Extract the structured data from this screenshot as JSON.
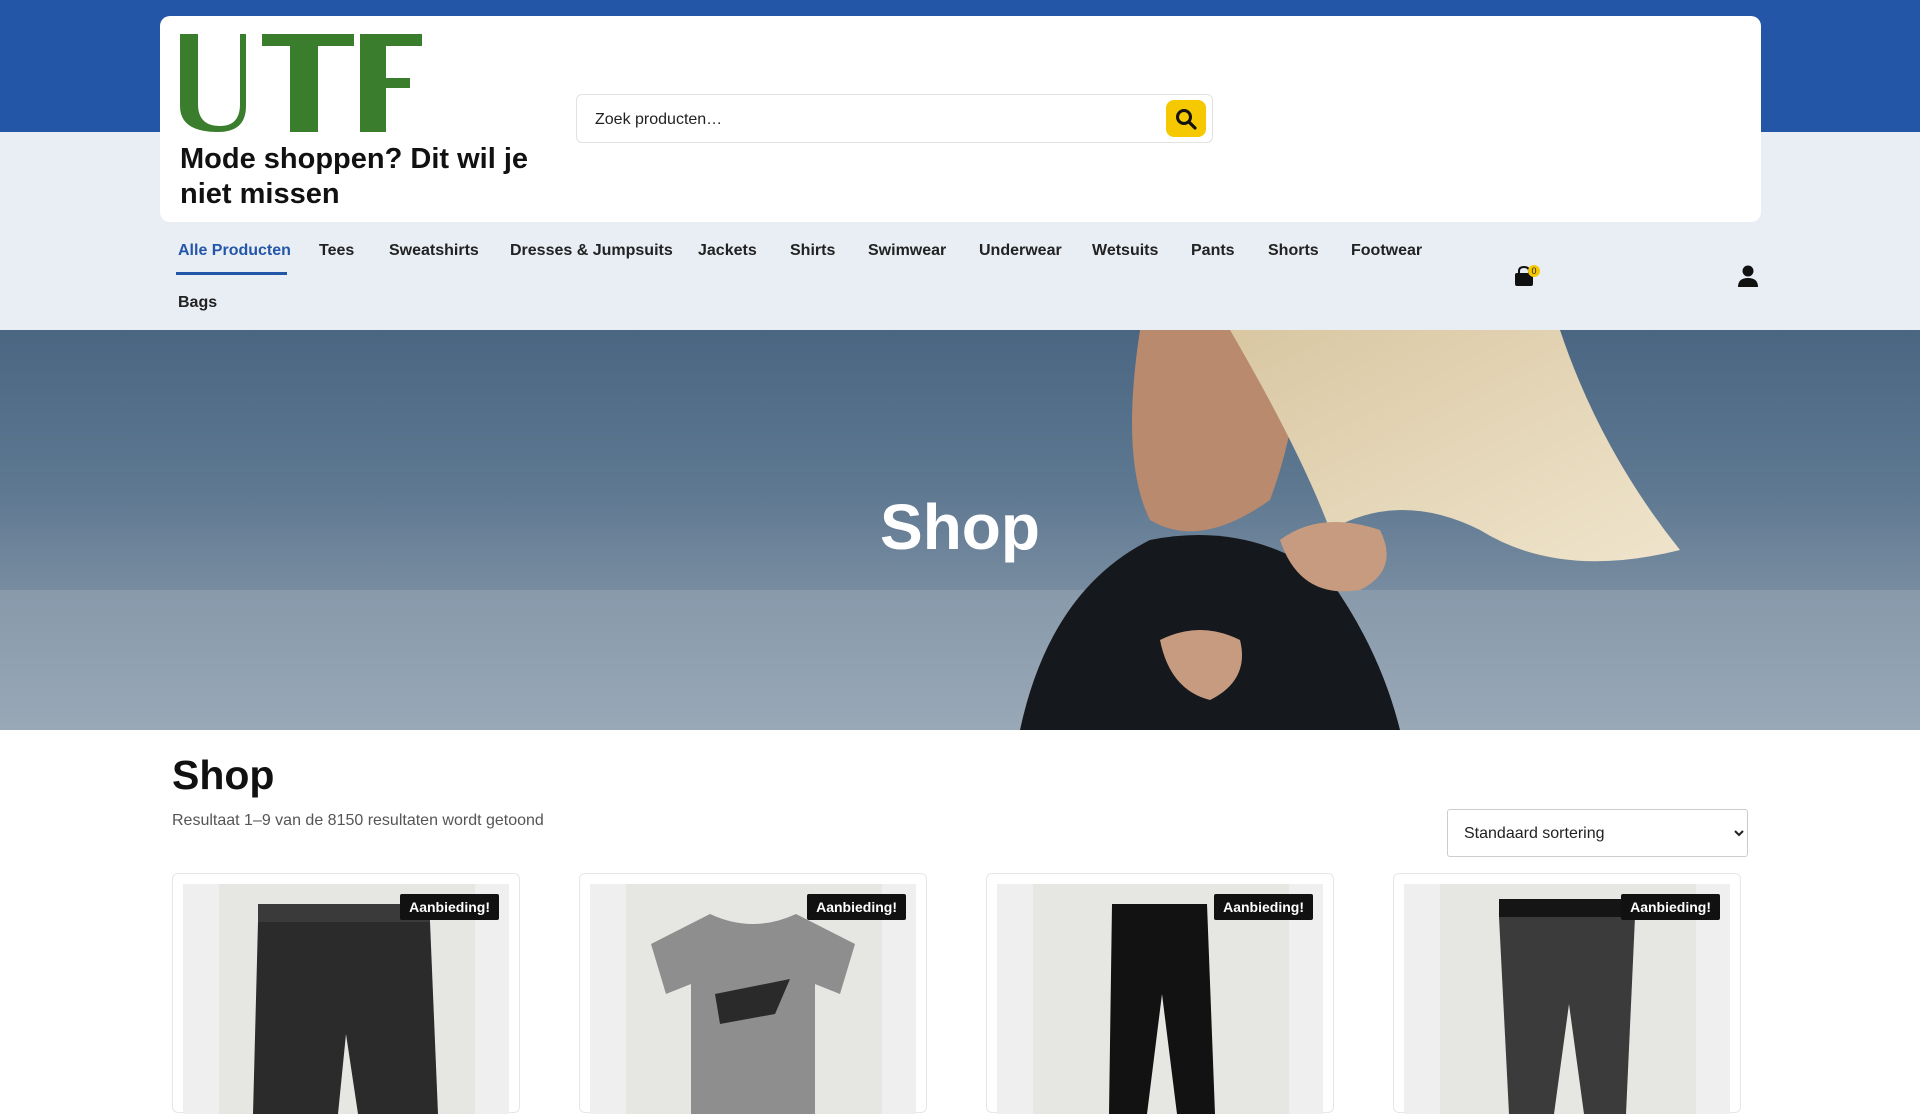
{
  "brand": {
    "logo_text": "UTF",
    "tagline": "Mode shoppen? Dit wil je niet missen",
    "logo_color": "#3a7d2c"
  },
  "colors": {
    "primary": "#2456a8",
    "accent": "#f5c800",
    "header_bg": "#e9eef5"
  },
  "search": {
    "placeholder": "Zoek producten…",
    "icon": "search-icon"
  },
  "nav": {
    "items": [
      {
        "label": "Alle Producten",
        "active": true
      },
      {
        "label": "Tees"
      },
      {
        "label": "Sweatshirts"
      },
      {
        "label": "Dresses & Jumpsuits"
      },
      {
        "label": "Jackets"
      },
      {
        "label": "Shirts"
      },
      {
        "label": "Swimwear"
      },
      {
        "label": "Underwear"
      },
      {
        "label": "Wetsuits"
      },
      {
        "label": "Pants"
      },
      {
        "label": "Shorts"
      },
      {
        "label": "Footwear"
      },
      {
        "label": "Bags"
      }
    ],
    "cart": {
      "icon": "shopping-bag-icon",
      "count": "0"
    },
    "account": {
      "icon": "user-icon"
    }
  },
  "hero": {
    "title": "Shop"
  },
  "main": {
    "title": "Shop",
    "result_count": "Resultaat 1–9 van de 8150 resultaten wordt getoond",
    "sort": {
      "selected": "Standaard sortering",
      "options": [
        "Standaard sortering"
      ]
    }
  },
  "products": [
    {
      "badge": "Aanbieding!",
      "kind": "shorts"
    },
    {
      "badge": "Aanbieding!",
      "kind": "tee"
    },
    {
      "badge": "Aanbieding!",
      "kind": "leggings-black"
    },
    {
      "badge": "Aanbieding!",
      "kind": "leggings-grey"
    }
  ]
}
